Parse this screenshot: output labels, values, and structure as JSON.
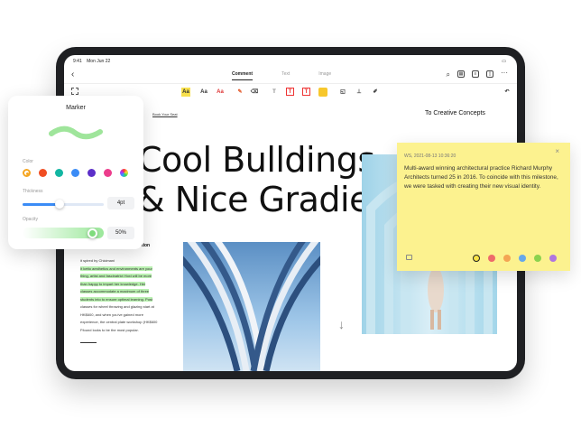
{
  "statusbar": {
    "time": "9:41",
    "date": "Mon Jun 22",
    "right": "100%"
  },
  "topbar": {
    "tabs": [
      {
        "label": "Comment",
        "active": true
      },
      {
        "label": "Text",
        "active": false
      },
      {
        "label": "Image",
        "active": false
      }
    ]
  },
  "toolbar": {
    "tools": [
      "Aa",
      "Aa",
      "Aa",
      "T",
      "T",
      "T"
    ]
  },
  "doc": {
    "link": "Book Your Seat",
    "header_right": "To Creative Concepts",
    "headline_1": "Cool Bulldings",
    "headline_2": "& Nice Gradie",
    "edition": "e Edition",
    "lines": [
      "it spired by Chicimani",
      "It ketto aesthetics and environments are your",
      "thing, artist and fascinatrict Hoxi will be more",
      "than happy to impart her knowledge. Her",
      "classes accommodate a maximum of three",
      "students into to ensure optimal learning. Post",
      "classes for wheel throwing and glazing start at",
      "HK$600, and when you've gained more",
      "experience, the central plate workshop (HK$600",
      "Ffound looks to be the most popular."
    ],
    "highlighted": [
      1,
      2,
      3,
      4,
      5
    ]
  },
  "marker": {
    "title": "Marker",
    "color_label": "Color",
    "thickness_label": "Thickness",
    "thickness_value": "4pt",
    "thickness_fraction": 0.45,
    "opacity_label": "Opacity",
    "opacity_value": "50%",
    "opacity_fraction": 0.5,
    "stroke_color": "#9fe59b",
    "colors": [
      "#f5a623",
      "#f04e23",
      "#13b6a2",
      "#3b8cf6",
      "#5c2fc9",
      "#ec3d8c"
    ]
  },
  "note": {
    "meta": "WS, 2021-08-13 10:36:20",
    "text": "Multi-award winning architectural practice Richard Murphy Architects turned 25 in 2016. To coincide with this milestone, we were tasked with creating their new visual identity.",
    "colors": [
      "#f7e246",
      "#ee6a6a",
      "#f4a553",
      "#66a8ea",
      "#8bd24e",
      "#b076e0"
    ],
    "selected": 0
  },
  "accent": "#3b8cf6"
}
